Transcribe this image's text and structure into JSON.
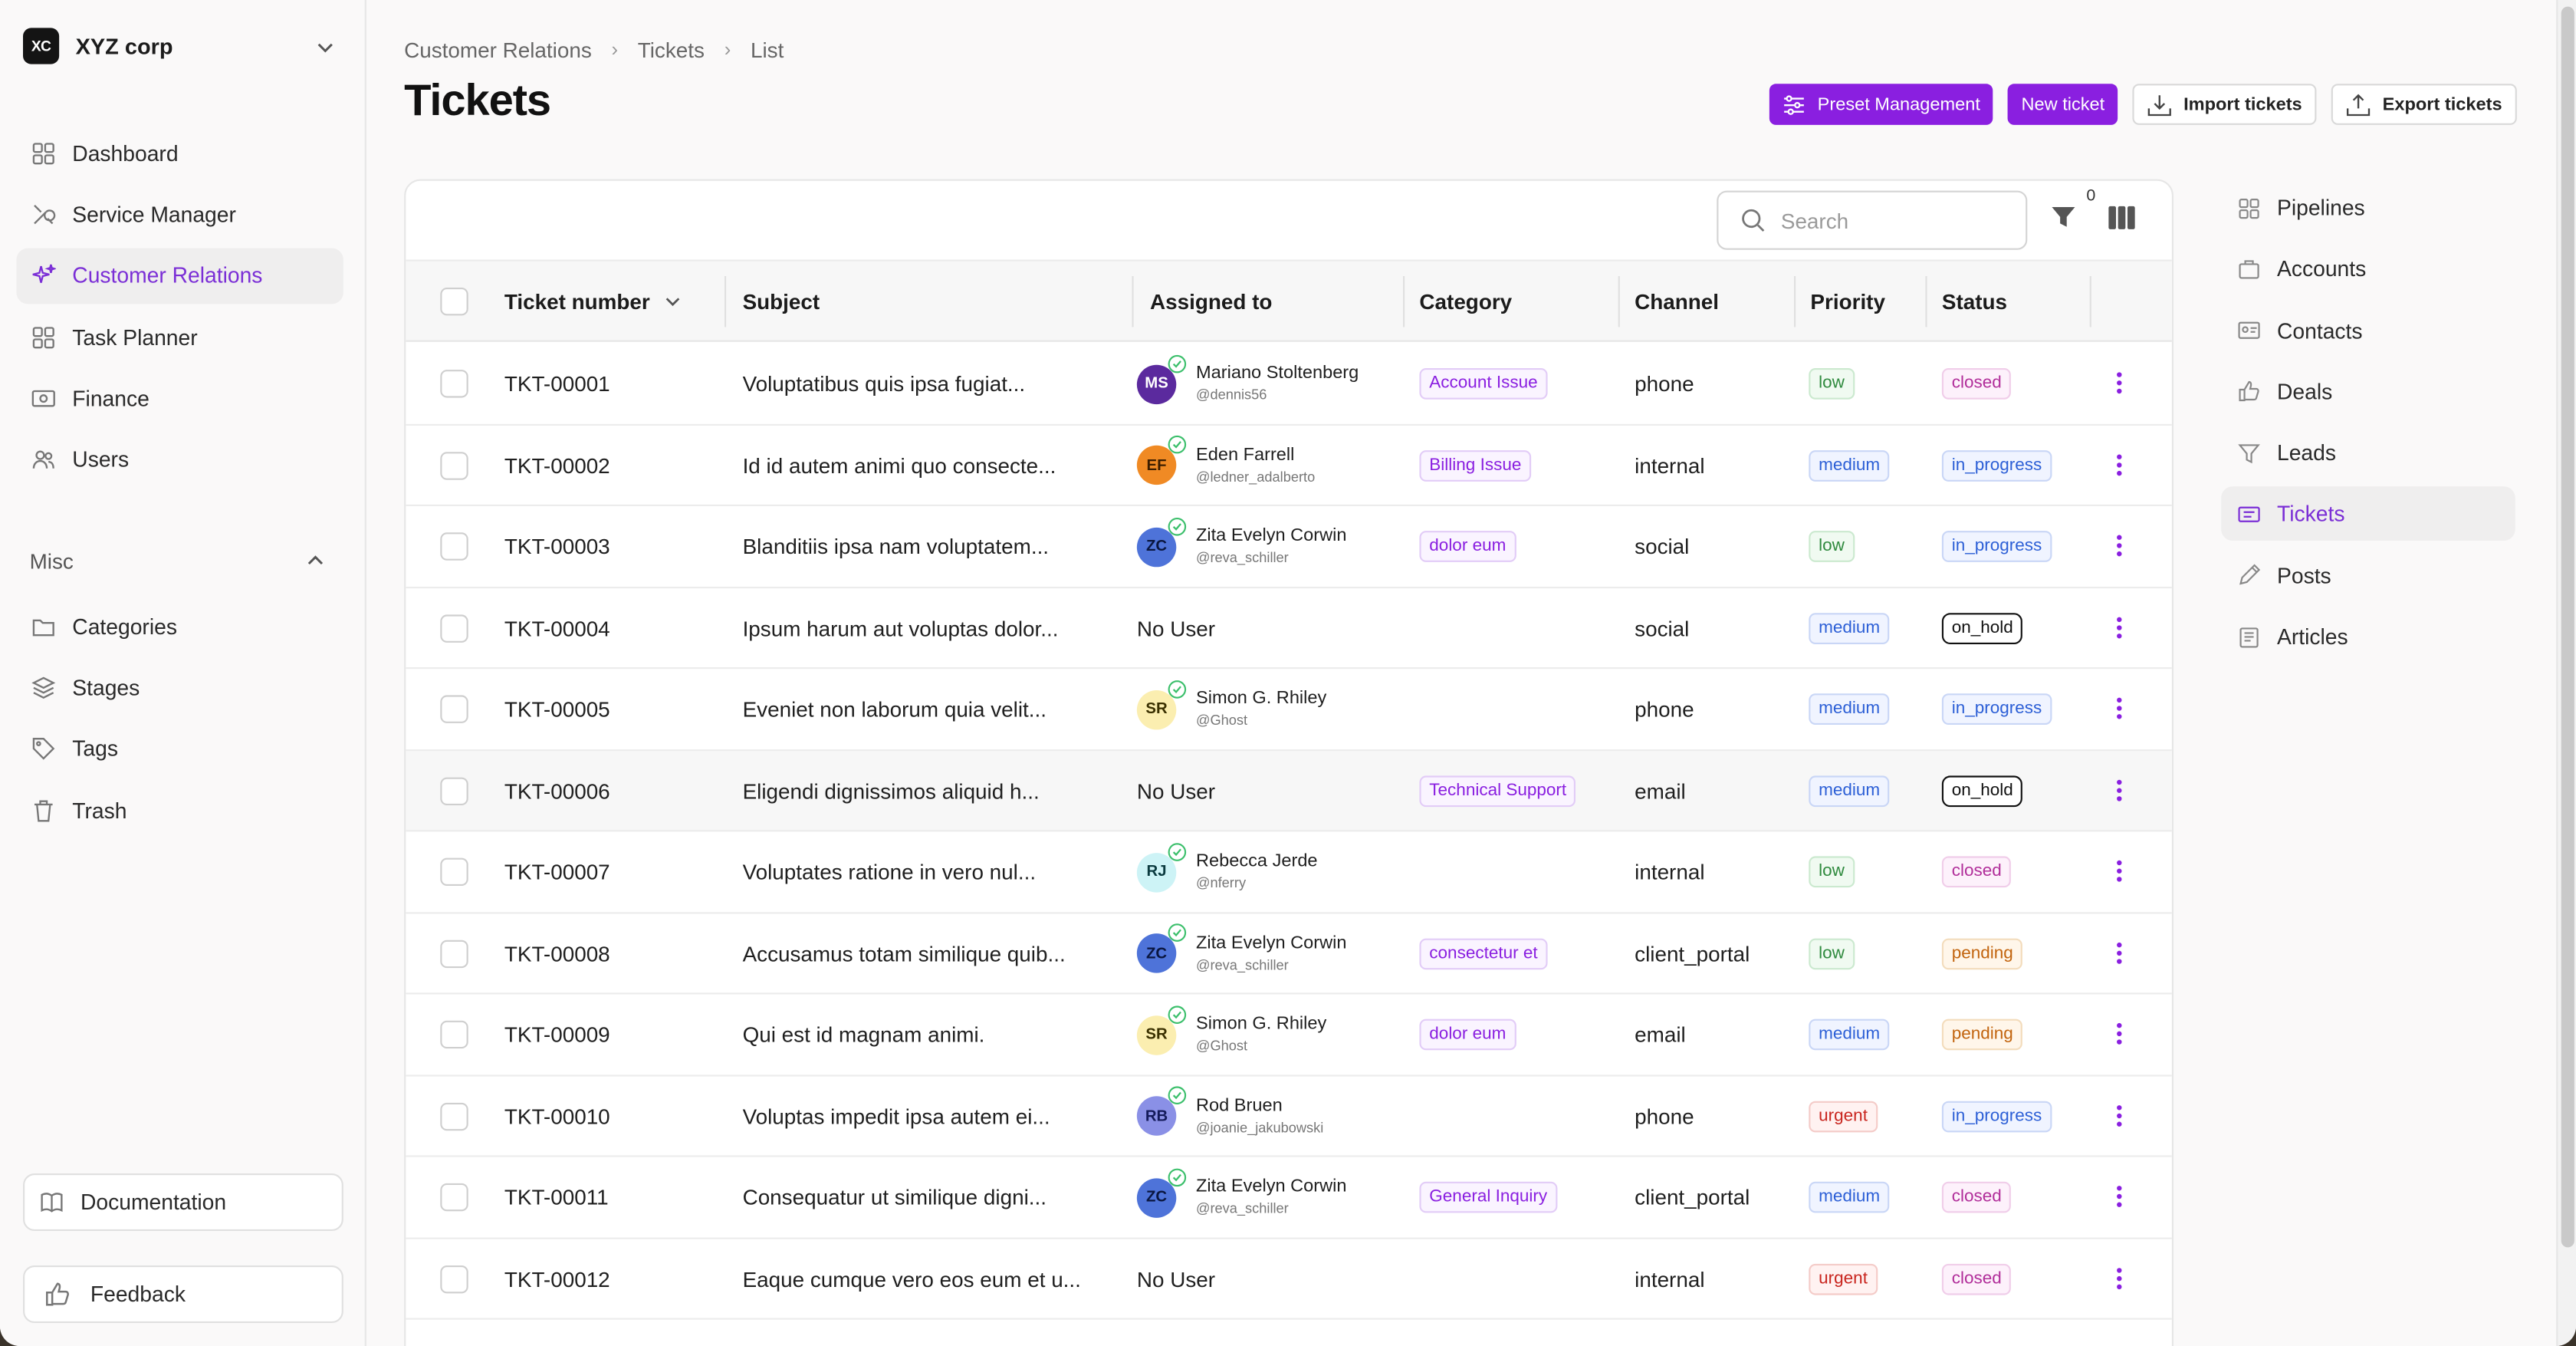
{
  "org": {
    "logo_text": "XC",
    "name": "XYZ corp"
  },
  "sidebar": {
    "items": [
      {
        "label": "Dashboard",
        "icon": "grid-icon",
        "active": false
      },
      {
        "label": "Service Manager",
        "icon": "tools-icon",
        "active": false
      },
      {
        "label": "Customer Relations",
        "icon": "sparkle-icon",
        "active": true
      },
      {
        "label": "Task Planner",
        "icon": "grid-icon",
        "active": false
      },
      {
        "label": "Finance",
        "icon": "money-icon",
        "active": false
      },
      {
        "label": "Users",
        "icon": "users-icon",
        "active": false
      }
    ],
    "misc_label": "Misc",
    "misc_items": [
      {
        "label": "Categories",
        "icon": "folder-icon"
      },
      {
        "label": "Stages",
        "icon": "layers-icon"
      },
      {
        "label": "Tags",
        "icon": "tag-icon"
      },
      {
        "label": "Trash",
        "icon": "trash-icon"
      }
    ],
    "documentation_label": "Documentation",
    "feedback_label": "Feedback"
  },
  "breadcrumb": [
    "Customer Relations",
    "Tickets",
    "List"
  ],
  "page_title": "Tickets",
  "actions": {
    "preset": "Preset Management",
    "new_ticket": "New ticket",
    "import": "Import tickets",
    "export": "Export tickets"
  },
  "toolbar": {
    "search_placeholder": "Search",
    "filter_count": "0"
  },
  "columns": [
    "Ticket number",
    "Subject",
    "Assigned to",
    "Category",
    "Channel",
    "Priority",
    "Status"
  ],
  "rows": [
    {
      "number": "TKT-00001",
      "subject": "Voluptatibus quis ipsa fugiat...",
      "user": {
        "initials": "MS",
        "name": "Mariano Stoltenberg",
        "handle": "@dennis56",
        "color": "#5b2a9e",
        "text": "#ffffff"
      },
      "category": "Account Issue",
      "channel": "phone",
      "priority": "low",
      "status": "closed"
    },
    {
      "number": "TKT-00002",
      "subject": "Id id autem animi quo consecte...",
      "user": {
        "initials": "EF",
        "name": "Eden Farrell",
        "handle": "@ledner_adalberto",
        "color": "#f08a24",
        "text": "#3b1d00"
      },
      "category": "Billing Issue",
      "channel": "internal",
      "priority": "medium",
      "status": "in_progress"
    },
    {
      "number": "TKT-00003",
      "subject": "Blanditiis ipsa nam voluptatem...",
      "user": {
        "initials": "ZC",
        "name": "Zita Evelyn Corwin",
        "handle": "@reva_schiller",
        "color": "#4e73d9",
        "text": "#0a1640"
      },
      "category": "dolor eum",
      "channel": "social",
      "priority": "low",
      "status": "in_progress"
    },
    {
      "number": "TKT-00004",
      "subject": "Ipsum harum aut voluptas dolor...",
      "user": null,
      "no_user": "No User",
      "category": "",
      "channel": "social",
      "priority": "medium",
      "status": "on_hold"
    },
    {
      "number": "TKT-00005",
      "subject": "Eveniet non laborum quia velit...",
      "user": {
        "initials": "SR",
        "name": "Simon G. Rhiley",
        "handle": "@Ghost",
        "color": "#fbeeb0",
        "text": "#3a3000"
      },
      "category": "",
      "channel": "phone",
      "priority": "medium",
      "status": "in_progress"
    },
    {
      "number": "TKT-00006",
      "subject": "Eligendi dignissimos aliquid h...",
      "user": null,
      "no_user": "No User",
      "category": "Technical Support",
      "channel": "email",
      "priority": "medium",
      "status": "on_hold"
    },
    {
      "number": "TKT-00007",
      "subject": "Voluptates ratione in vero nul...",
      "user": {
        "initials": "RJ",
        "name": "Rebecca Jerde",
        "handle": "@nferry",
        "color": "#cdf3f6",
        "text": "#0b3b40"
      },
      "category": "",
      "channel": "internal",
      "priority": "low",
      "status": "closed"
    },
    {
      "number": "TKT-00008",
      "subject": "Accusamus totam similique quib...",
      "user": {
        "initials": "ZC",
        "name": "Zita Evelyn Corwin",
        "handle": "@reva_schiller",
        "color": "#4e73d9",
        "text": "#0a1640"
      },
      "category": "consectetur et",
      "channel": "client_portal",
      "priority": "low",
      "status": "pending"
    },
    {
      "number": "TKT-00009",
      "subject": "Qui est id magnam animi.",
      "user": {
        "initials": "SR",
        "name": "Simon G. Rhiley",
        "handle": "@Ghost",
        "color": "#fbeeb0",
        "text": "#3a3000"
      },
      "category": "dolor eum",
      "channel": "email",
      "priority": "medium",
      "status": "pending"
    },
    {
      "number": "TKT-00010",
      "subject": "Voluptas impedit ipsa autem ei...",
      "user": {
        "initials": "RB",
        "name": "Rod Bruen",
        "handle": "@joanie_jakubowski",
        "color": "#8a90e6",
        "text": "#141a5a"
      },
      "category": "",
      "channel": "phone",
      "priority": "urgent",
      "status": "in_progress"
    },
    {
      "number": "TKT-00011",
      "subject": "Consequatur ut similique digni...",
      "user": {
        "initials": "ZC",
        "name": "Zita Evelyn Corwin",
        "handle": "@reva_schiller",
        "color": "#4e73d9",
        "text": "#0a1640"
      },
      "category": "General Inquiry",
      "channel": "client_portal",
      "priority": "medium",
      "status": "closed"
    },
    {
      "number": "TKT-00012",
      "subject": "Eaque cumque vero eos eum et u...",
      "user": null,
      "no_user": "No User",
      "category": "",
      "channel": "internal",
      "priority": "urgent",
      "status": "closed"
    }
  ],
  "badge_colors": {
    "low": {
      "fg": "#2f8a3e",
      "bg": "#f0faf1",
      "border": "#cbe9cf"
    },
    "medium": {
      "fg": "#2c5fd6",
      "bg": "#f0f4ff",
      "border": "#c9d6f6"
    },
    "urgent": {
      "fg": "#c9261f",
      "bg": "#fff2f1",
      "border": "#f4cbc8"
    },
    "closed": {
      "fg": "#b12e9a",
      "bg": "#fdf1fb",
      "border": "#f0cde9"
    },
    "in_progress": {
      "fg": "#2c5fd6",
      "bg": "#f0f4ff",
      "border": "#c9d6f6"
    },
    "on_hold": {
      "fg": "#111111",
      "bg": "#ffffff",
      "border": "#111111"
    },
    "pending": {
      "fg": "#c2640e",
      "bg": "#fff6ea",
      "border": "#f3dcbc"
    },
    "category": {
      "fg": "#8a1fe0",
      "bg": "#faf4ff",
      "border": "#e2ccf7"
    }
  },
  "right_nav": {
    "items": [
      {
        "label": "Pipelines",
        "icon": "grid-icon",
        "active": false
      },
      {
        "label": "Accounts",
        "icon": "briefcase-icon",
        "active": false
      },
      {
        "label": "Contacts",
        "icon": "contact-card-icon",
        "active": false
      },
      {
        "label": "Deals",
        "icon": "thumbs-up-icon",
        "active": false
      },
      {
        "label": "Leads",
        "icon": "funnel-icon",
        "active": false
      },
      {
        "label": "Tickets",
        "icon": "ticket-icon",
        "active": true
      },
      {
        "label": "Posts",
        "icon": "pencil-icon",
        "active": false
      },
      {
        "label": "Articles",
        "icon": "article-icon",
        "active": false
      }
    ]
  },
  "accent_color": "#8a1fe0"
}
